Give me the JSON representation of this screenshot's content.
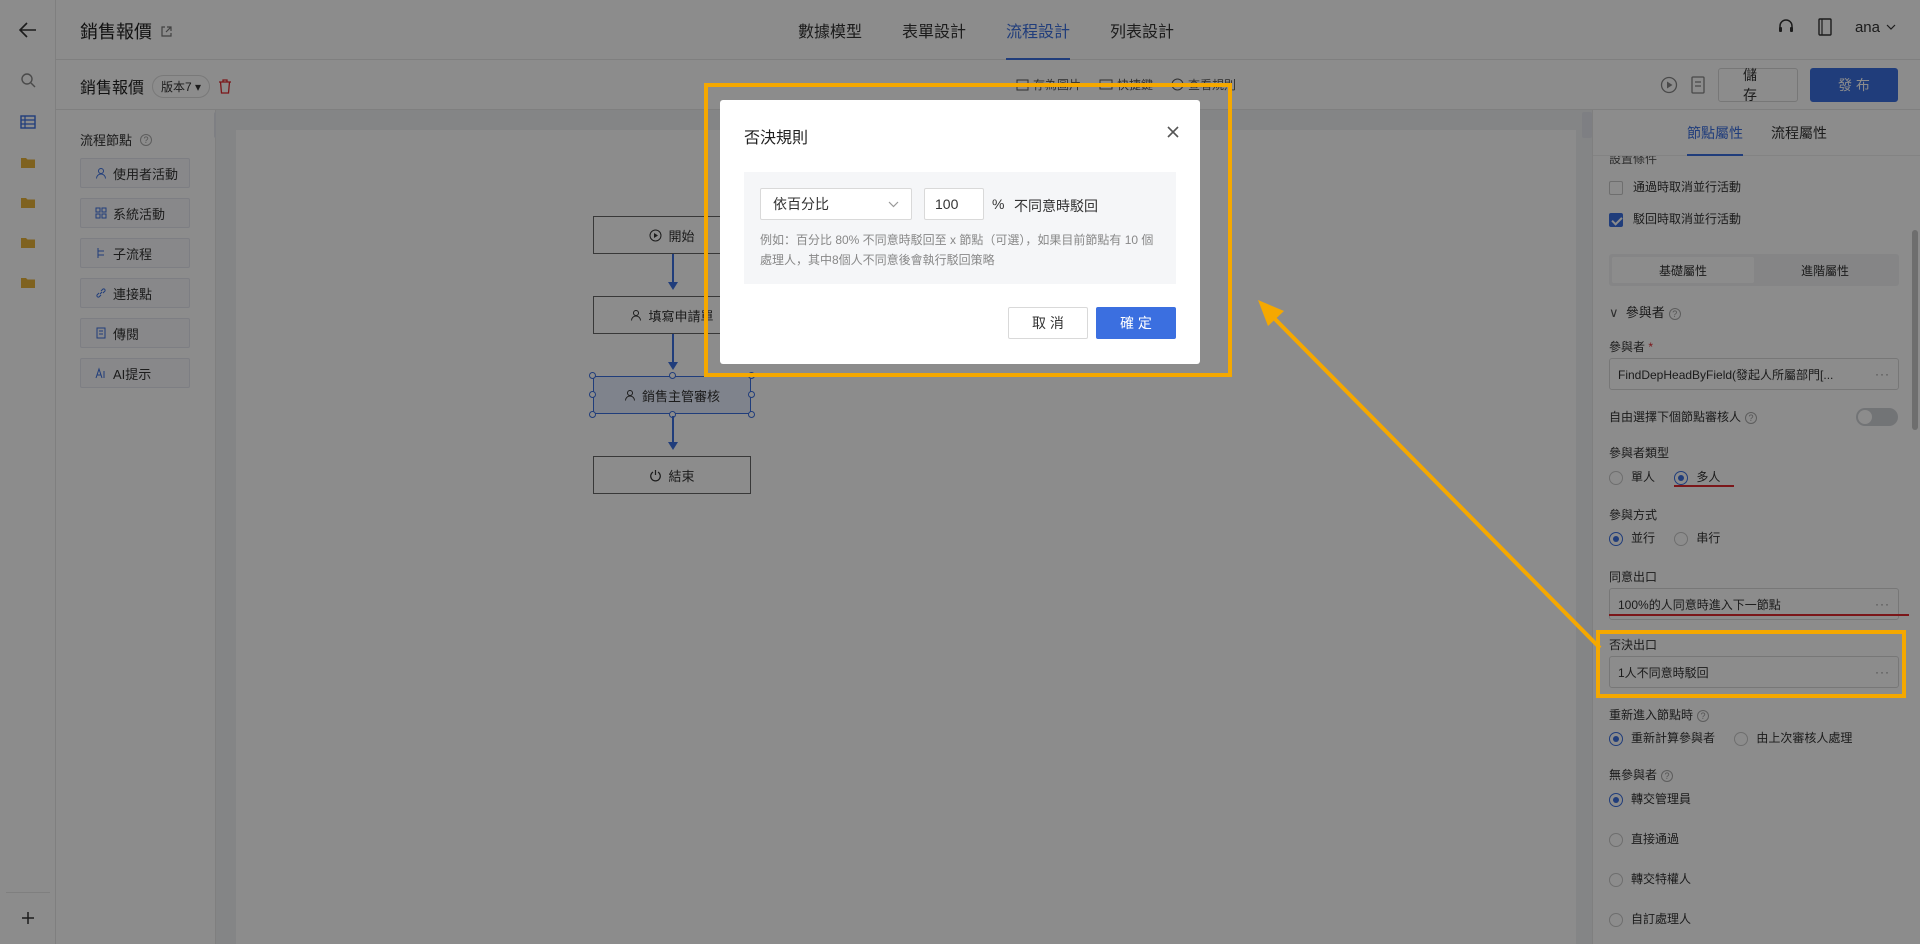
{
  "app": {
    "title": "銷售報價",
    "tabs": [
      "數據模型",
      "表單設計",
      "流程設計",
      "列表設計"
    ],
    "active_tab": "流程設計",
    "user": "ana"
  },
  "toolbar": {
    "page_name": "銷售報價",
    "version": "版本7",
    "items": [
      "存為圖片",
      "快捷鍵",
      "查看規則"
    ],
    "save_label": "儲 存",
    "publish_label": "發 布"
  },
  "palette": {
    "title": "流程節點",
    "items": [
      {
        "label": "使用者活動",
        "icon": "user-icon"
      },
      {
        "label": "系統活動",
        "icon": "grid-icon"
      },
      {
        "label": "子流程",
        "icon": "tree-icon"
      },
      {
        "label": "連接點",
        "icon": "link-icon"
      },
      {
        "label": "傳閱",
        "icon": "document-icon"
      },
      {
        "label": "AI提示",
        "icon": "ai-icon"
      }
    ]
  },
  "flow": {
    "nodes": [
      "開始",
      "填寫申請單",
      "銷售主管審核",
      "結束"
    ]
  },
  "right_panel": {
    "tabs": [
      "節點屬性",
      "流程屬性"
    ],
    "active_tab": "節點屬性",
    "section_header": "設置條件",
    "checkbox_1": "通過時取消並行活動",
    "checkbox_2": "駁回時取消並行活動",
    "seg_basic": "基礎屬性",
    "seg_advanced": "進階屬性",
    "participants_header": "參與者",
    "participant_label": "參與者",
    "participant_required": "*",
    "participant_value": "FindDepHeadByField(發起人所屬部門[...",
    "free_select_label": "自由選擇下個節點審核人",
    "type_label": "參與者類型",
    "type_single": "單人",
    "type_multi": "多人",
    "mode_label": "參與方式",
    "mode_parallel": "並行",
    "mode_serial": "串行",
    "agree_label": "同意出口",
    "agree_value": "100%的人同意時進入下一節點",
    "reject_label": "否決出口",
    "reject_value": "1人不同意時駁回",
    "reenter_label": "重新進入節點時",
    "reenter_opt1": "重新計算參與者",
    "reenter_opt2": "由上次審核人處理",
    "none_label": "無參與者",
    "none_opt1": "轉交管理員",
    "none_opt2": "直接通過",
    "none_opt3": "轉交特權人",
    "none_opt4": "自訂處理人",
    "more_dots": "···"
  },
  "modal": {
    "title": "否決規則",
    "select_value": "依百分比",
    "number_value": "100",
    "percent_sign": "%",
    "reject_text": "不同意時駁回",
    "hint": "例如：百分比 80% 不同意時駁回至 x 節點（可選），如果目前節點有 10 個處理人，其中8個人不同意後會執行駁回策略",
    "cancel_label": "取 消",
    "ok_label": "確 定"
  },
  "colors": {
    "accent": "#3b6fe0",
    "annotation": "#f5a800",
    "underline": "#e0292f"
  }
}
